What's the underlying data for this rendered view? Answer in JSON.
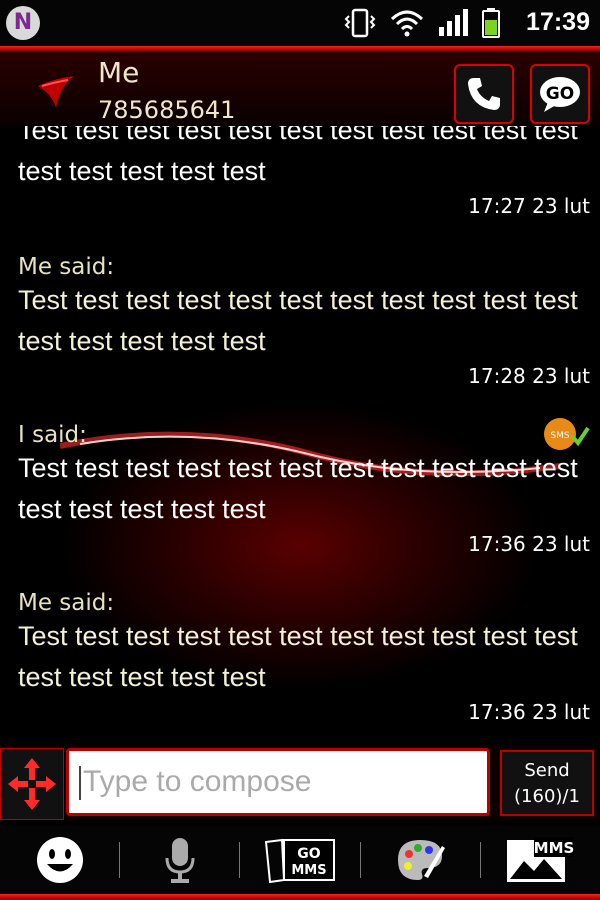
{
  "status_bar": {
    "app_icon_letter": "N",
    "time": "17:39"
  },
  "header": {
    "contact_name": "Me",
    "contact_number": "785685641"
  },
  "messages": [
    {
      "sender": "",
      "body": "Test test test test test test test test test test test test test test test test",
      "timestamp": "17:27 23 lut",
      "from_me": false
    },
    {
      "sender": "Me said:",
      "body": "Test test test test test test test test test test test test test test test test",
      "timestamp": "17:28 23 lut",
      "from_me": true
    },
    {
      "sender": "I said:",
      "body": "Test test test test test test test test test test test test test test test test",
      "timestamp": "17:36 23 lut",
      "from_me": false
    },
    {
      "sender": "Me said:",
      "body": "Test test test test test test test test test test test test test test test test",
      "timestamp": "17:36 23 lut",
      "from_me": true
    }
  ],
  "compose": {
    "placeholder": "Type to compose",
    "send_label": "Send",
    "send_count": "(160)/1"
  },
  "toolbar": {
    "go_mms_label": "GO MMS",
    "mms_label": "MMS",
    "sms_badge": "SMS"
  },
  "colors": {
    "accent": "#d00000",
    "background": "#000000",
    "me_text": "#f4f0d6"
  }
}
